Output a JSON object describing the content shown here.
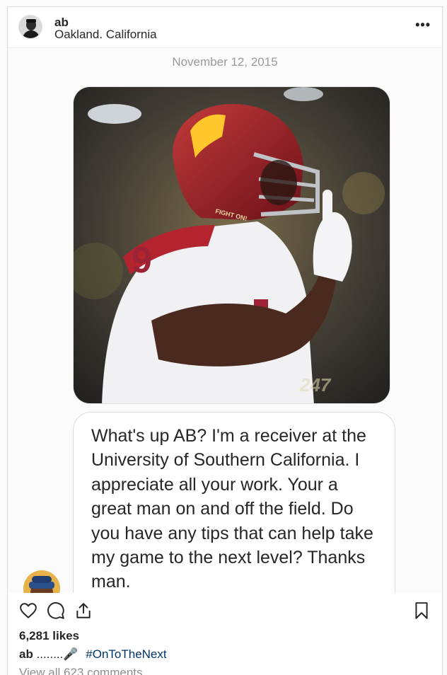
{
  "post": {
    "username": "ab",
    "location": "Oakland. California",
    "more_icon": "more-horizontal-icon"
  },
  "message": {
    "date": "November 12, 2015",
    "text": "What's up AB? I'm a receiver at the University of Southern California. I appreciate all your work. Your a great man on and off the field. Do you have any tips that can help take my game to the next level? Thanks man.",
    "photo": {
      "jersey_number": "9",
      "helmet_text": "FIGHT ON!",
      "watermark": "247"
    }
  },
  "actions": {
    "icons": [
      "heart-icon",
      "comment-icon",
      "share-icon",
      "bookmark-icon"
    ],
    "likes": "6,281 likes",
    "caption_user": "ab",
    "caption_text": "........🎤",
    "caption_hashtag": "#OnToTheNext",
    "view_comments": "View all 623 comments"
  },
  "colors": {
    "hashtag": "#003569",
    "usc_cardinal": "#9d2235",
    "usc_gold": "#ffc72c"
  }
}
